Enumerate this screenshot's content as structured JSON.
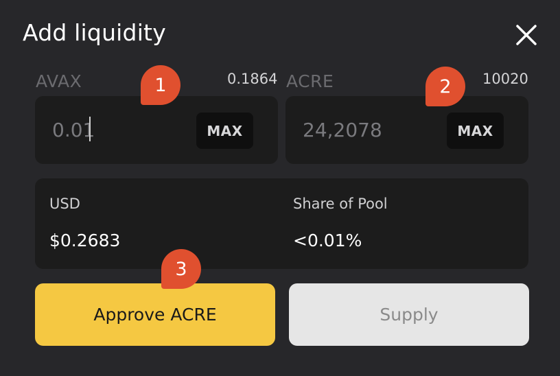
{
  "modal": {
    "title": "Add liquidity",
    "close_icon": "close-icon"
  },
  "token_a": {
    "symbol": "AVAX",
    "balance": "0.1864",
    "amount": "0.01",
    "max_label": "MAX"
  },
  "token_b": {
    "symbol": "ACRE",
    "balance": "10020",
    "amount": "24,2078",
    "max_label": "MAX"
  },
  "info": {
    "usd_label": "USD",
    "usd_value": "$0.2683",
    "share_label": "Share of Pool",
    "share_value": "<0.01%"
  },
  "buttons": {
    "approve_label": "Approve ACRE",
    "supply_label": "Supply"
  },
  "step_markers": [
    "1",
    "2",
    "3"
  ],
  "colors": {
    "background": "#27272a",
    "panel": "#1c1c1c",
    "approve": "#f5c842",
    "supply": "#e6e6e6",
    "marker": "#e0502f"
  }
}
